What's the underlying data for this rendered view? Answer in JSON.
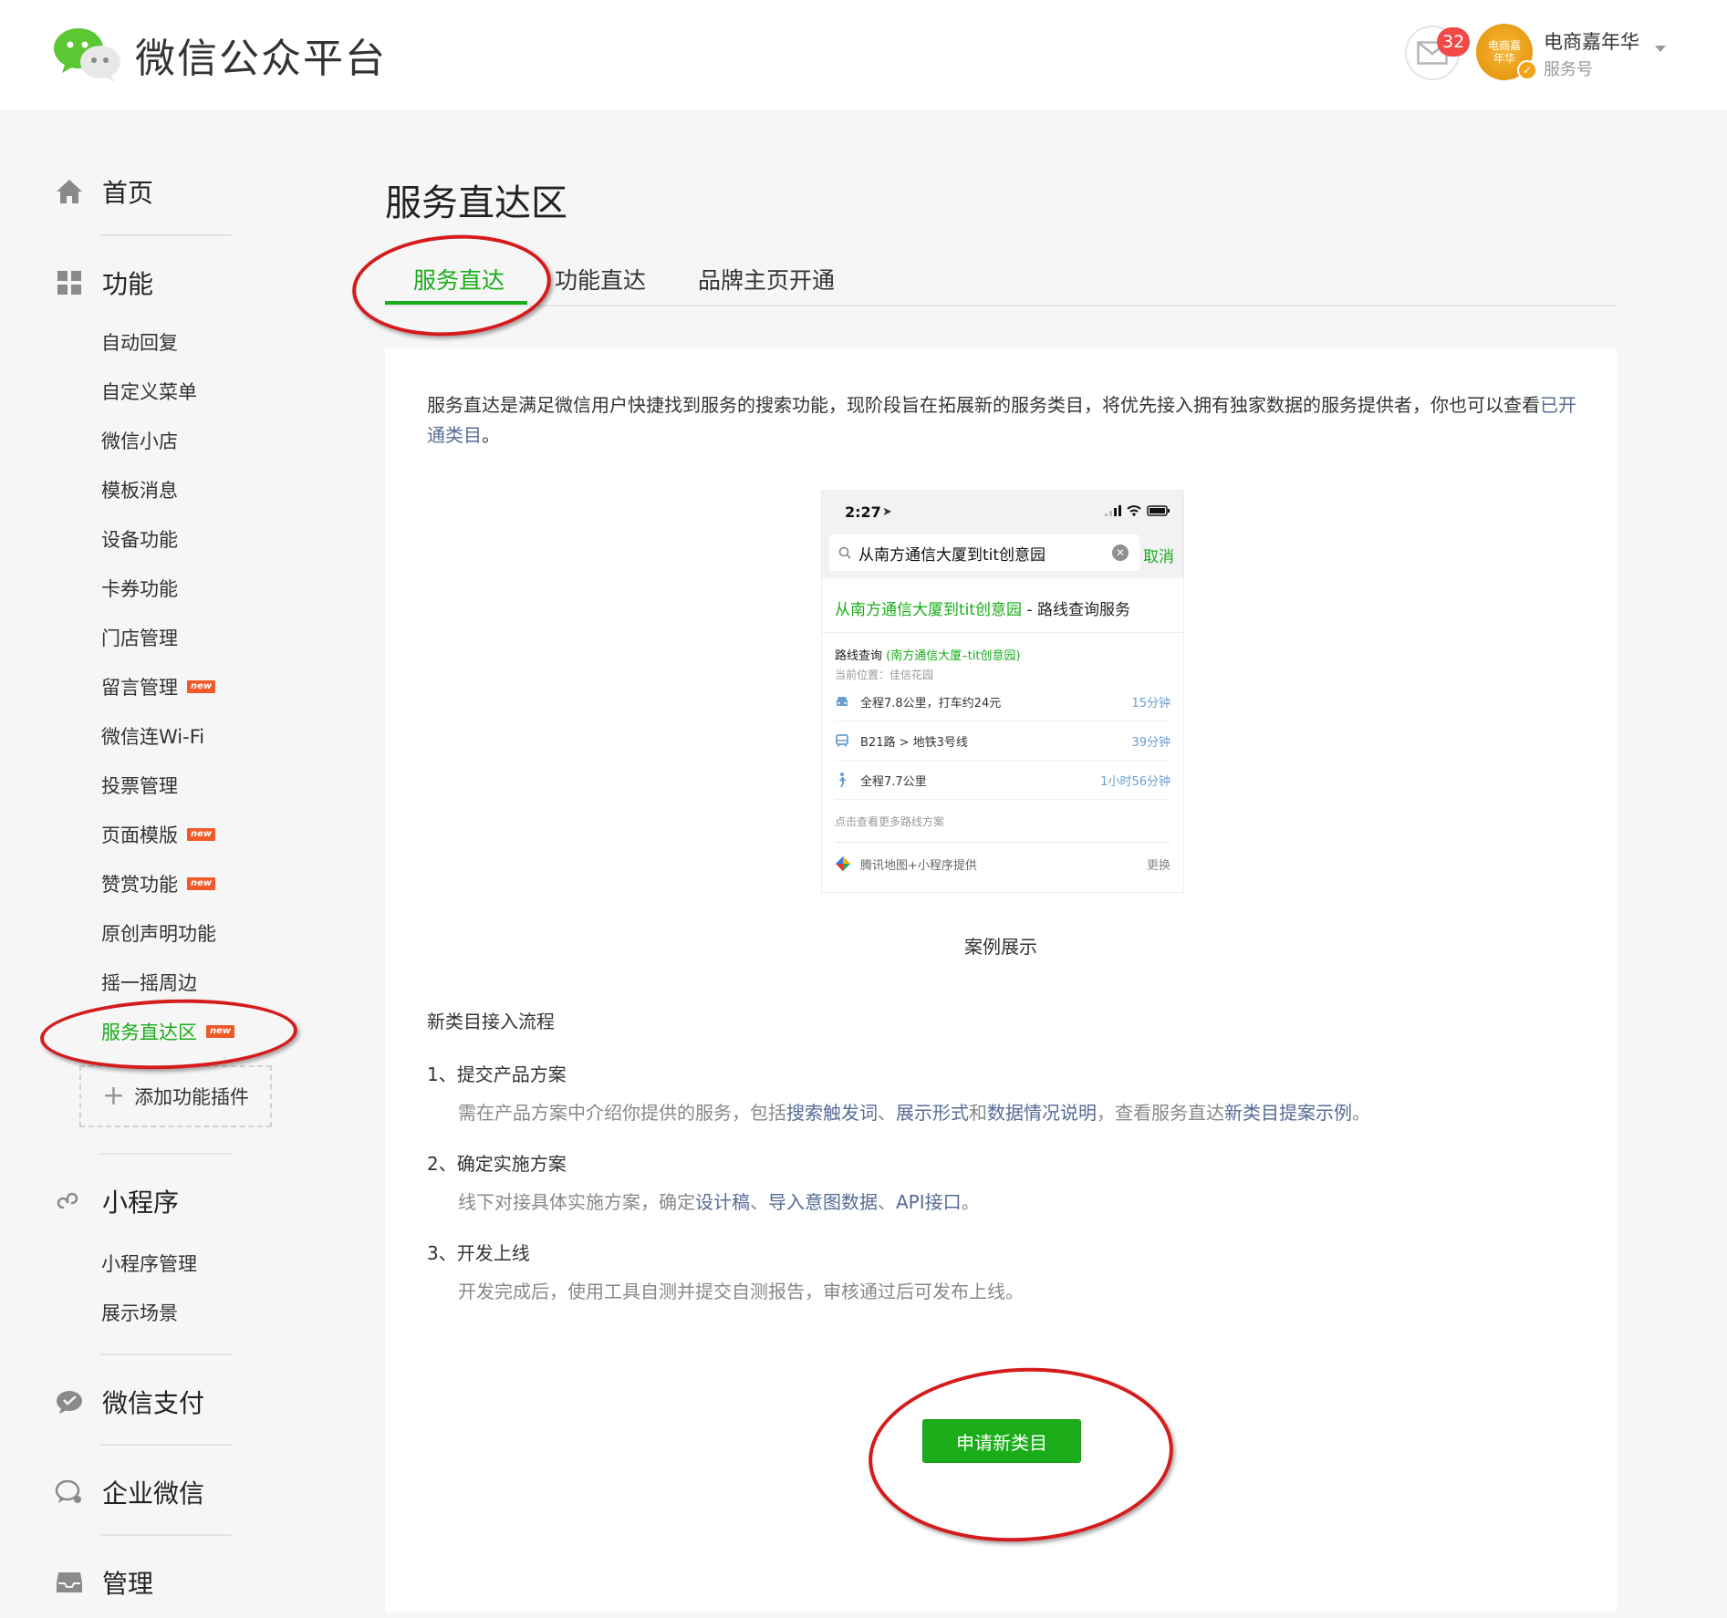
{
  "header": {
    "logo_text": "微信公众平台",
    "mail_badge": "32",
    "account_name": "电商嘉年华",
    "account_type": "服务号",
    "avatar_text": "电商嘉年华"
  },
  "sidebar": {
    "home": "首页",
    "features": "功能",
    "feature_items": [
      {
        "label": "自动回复",
        "new": false
      },
      {
        "label": "自定义菜单",
        "new": false
      },
      {
        "label": "微信小店",
        "new": false
      },
      {
        "label": "模板消息",
        "new": false
      },
      {
        "label": "设备功能",
        "new": false
      },
      {
        "label": "卡券功能",
        "new": false
      },
      {
        "label": "门店管理",
        "new": false
      },
      {
        "label": "留言管理",
        "new": true
      },
      {
        "label": "微信连Wi-Fi",
        "new": false
      },
      {
        "label": "投票管理",
        "new": false
      },
      {
        "label": "页面模版",
        "new": true
      },
      {
        "label": "赞赏功能",
        "new": true
      },
      {
        "label": "原创声明功能",
        "new": false
      },
      {
        "label": "摇一摇周边",
        "new": false
      },
      {
        "label": "服务直达区",
        "new": true,
        "active": true
      }
    ],
    "new_tag": "new",
    "add_plugin": "添加功能插件",
    "miniprogram": "小程序",
    "miniprogram_items": [
      "小程序管理",
      "展示场景"
    ],
    "wechat_pay": "微信支付",
    "wework": "企业微信",
    "manage": "管理"
  },
  "main": {
    "title": "服务直达区",
    "tabs": [
      "服务直达",
      "功能直达",
      "品牌主页开通"
    ],
    "active_tab": 0,
    "intro_text": "服务直达是满足微信用户快捷找到服务的搜索功能，现阶段旨在拓展新的服务类目，将优先接入拥有独家数据的服务提供者，你也可以查看",
    "intro_link": "已开通类目",
    "intro_end": "。",
    "phone": {
      "time": "2:27",
      "search_text": "从南方通信大厦到tit创意园",
      "cancel": "取消",
      "result_title_green": "从南方通信大厦到tit创意园",
      "result_title_rest": " - 路线查询服务",
      "route_head": "路线查询",
      "route_head_green": "(南方通信大厦–tit创意园)",
      "current_pos": "当前位置：佳信花园",
      "routes": [
        {
          "icon": "car-icon",
          "text": "全程7.8公里，打车约24元",
          "time": "15分钟"
        },
        {
          "icon": "bus-icon",
          "text": "B21路 > 地铁3号线",
          "time": "39分钟"
        },
        {
          "icon": "walk-icon",
          "text": "全程7.7公里",
          "time": "1小时56分钟"
        }
      ],
      "more_routes": "点击查看更多路线方案",
      "provider": "腾讯地图+小程序提供",
      "change": "更换"
    },
    "caption": "案例展示",
    "flow_title": "新类目接入流程",
    "steps": [
      {
        "heading": "1、提交产品方案",
        "parts": [
          {
            "t": "需在产品方案中介绍你提供的服务，包括",
            "link": false
          },
          {
            "t": "搜索触发词",
            "link": true
          },
          {
            "t": "、",
            "link": false
          },
          {
            "t": "展示形式",
            "link": true
          },
          {
            "t": "和",
            "link": false
          },
          {
            "t": "数据情况说明",
            "link": true
          },
          {
            "t": "，查看服务直达",
            "link": false
          },
          {
            "t": "新类目提案示例",
            "link": true
          },
          {
            "t": "。",
            "link": false
          }
        ]
      },
      {
        "heading": "2、确定实施方案",
        "parts": [
          {
            "t": "线下对接具体实施方案，确定",
            "link": false
          },
          {
            "t": "设计稿",
            "link": true
          },
          {
            "t": "、",
            "link": false
          },
          {
            "t": "导入意图数据",
            "link": true
          },
          {
            "t": "、",
            "link": false
          },
          {
            "t": "API接口",
            "link": true
          },
          {
            "t": "。",
            "link": false
          }
        ]
      },
      {
        "heading": "3、开发上线",
        "parts": [
          {
            "t": "开发完成后，使用工具自测并提交自测报告，审核通过后可发布上线。",
            "link": false
          }
        ]
      }
    ],
    "apply_button": "申请新类目"
  },
  "colors": {
    "accent_green": "#1aad19",
    "link_blue": "#576b95",
    "badge_red": "#f14848",
    "annotation_red": "#d51b1b",
    "new_tag": "#f05a28"
  }
}
